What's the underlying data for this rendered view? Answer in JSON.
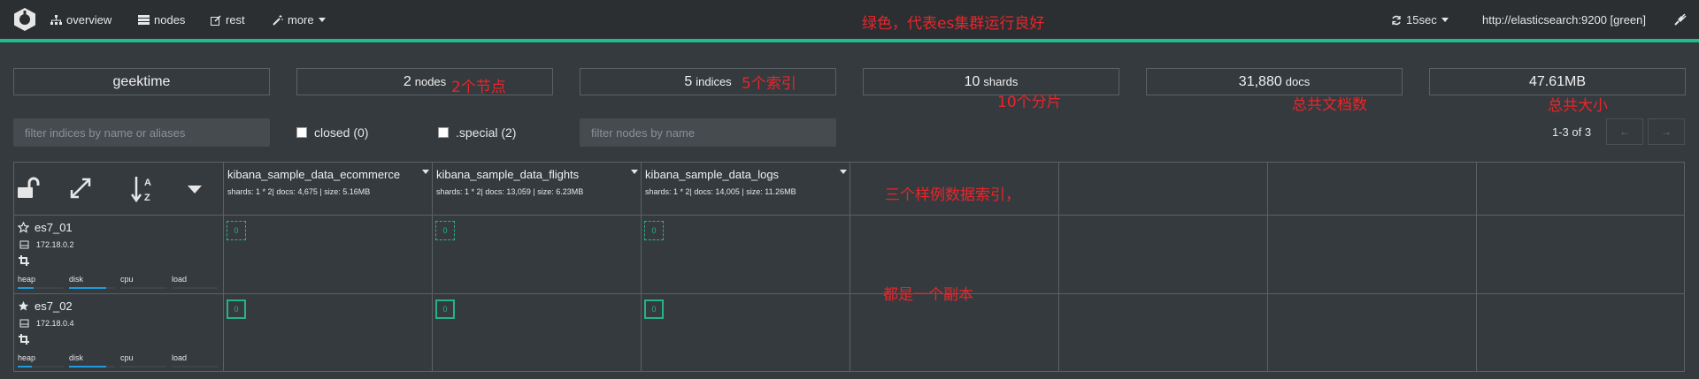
{
  "nav": {
    "overview": "overview",
    "nodes": "nodes",
    "rest": "rest",
    "more": "more",
    "refresh": "15sec",
    "cluster_url": "http://elasticsearch:9200 [green]",
    "status_color": "#1dbd8c"
  },
  "annotations": {
    "green": "绿色，代表es集群运行良好",
    "nodes": "2个节点",
    "indices": "5个索引",
    "shards": "10个分片",
    "docs": "总共文档数",
    "size": "总共大小",
    "sample": "三个样例数据索引，",
    "replica": "都是一个副本"
  },
  "stats": {
    "cluster_name": "geektime",
    "nodes_value": "2",
    "nodes_unit": "nodes",
    "indices_value": "5",
    "indices_unit": "indices",
    "shards_value": "10",
    "shards_unit": "shards",
    "docs_value": "31,880",
    "docs_unit": "docs",
    "size": "47.61MB"
  },
  "filters": {
    "indices_placeholder": "filter indices by name or aliases",
    "closed_label": "closed (0)",
    "special_label": ".special (2)",
    "nodes_placeholder": "filter nodes by name",
    "pager": "1-3 of 3",
    "prev": "←",
    "next": "→"
  },
  "indices": [
    {
      "name": "kibana_sample_data_ecommerce",
      "meta": "shards: 1 * 2| docs: 4,675 | size: 5.16MB"
    },
    {
      "name": "kibana_sample_data_flights",
      "meta": "shards: 1 * 2| docs: 13,059 | size: 6.23MB"
    },
    {
      "name": "kibana_sample_data_logs",
      "meta": "shards: 1 * 2| docs: 14,005 | size: 11.26MB"
    }
  ],
  "nodes": [
    {
      "name": "es7_01",
      "ip": "172.18.0.2",
      "master": false,
      "shard_label": "0",
      "metrics": {
        "heap": "heap",
        "disk": "disk",
        "cpu": "cpu",
        "load": "load"
      },
      "levels": {
        "heap": 0.35,
        "disk": 0.8,
        "cpu": 0.0,
        "load": 0.0
      }
    },
    {
      "name": "es7_02",
      "ip": "172.18.0.4",
      "master": true,
      "shard_label": "0",
      "metrics": {
        "heap": "heap",
        "disk": "disk",
        "cpu": "cpu",
        "load": "load"
      },
      "levels": {
        "heap": 0.3,
        "disk": 0.8,
        "cpu": 0.0,
        "load": 0.0
      }
    }
  ]
}
